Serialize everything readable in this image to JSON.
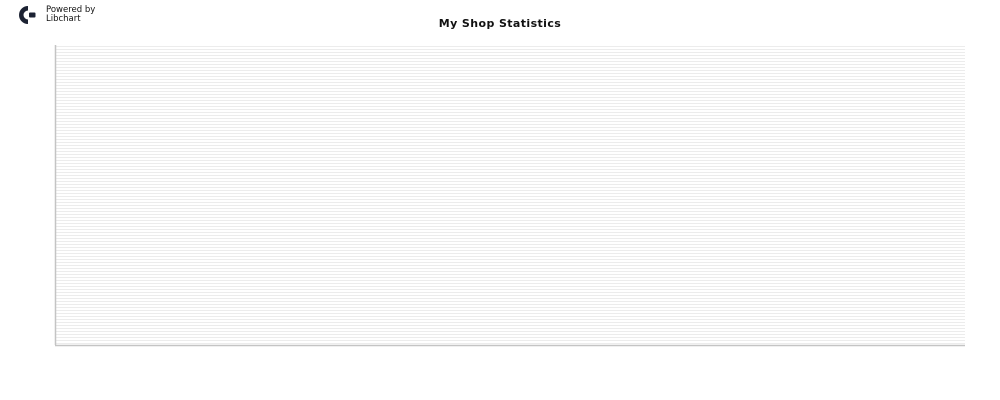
{
  "branding": {
    "line1": "Powered by",
    "line2": "Libchart",
    "logo_icon": "libchart-logo-icon"
  },
  "chart_data": {
    "type": "bar",
    "title": "My Shop Statistics",
    "categories": [],
    "values": [],
    "xlabel": "",
    "ylabel": "",
    "grid": true,
    "colors": {
      "plot_background": "#ffffff",
      "grid_stripe": "#ececec",
      "axis": "#c4c4c4"
    }
  }
}
